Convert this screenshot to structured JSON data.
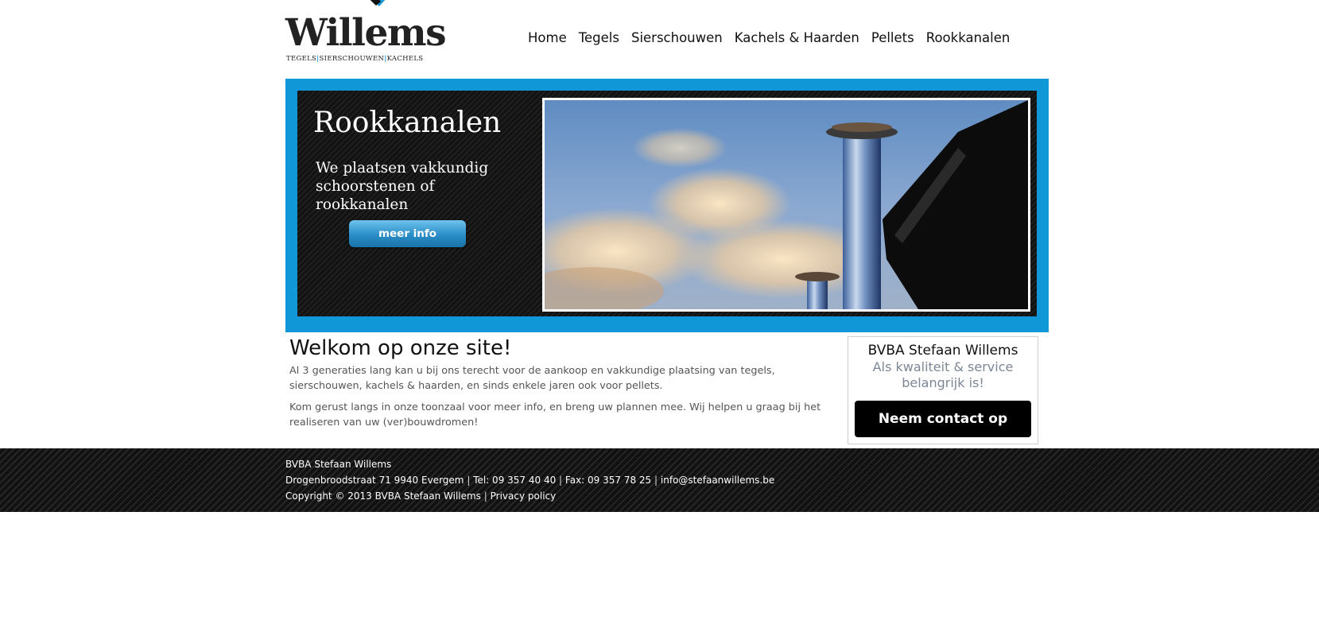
{
  "header": {
    "logo": {
      "word": "Willems",
      "tag_part1": "TEGELS",
      "tag_part2": "SIERSCHOUWEN",
      "tag_part3": "KACHELS",
      "tag_separator": "|",
      "accent_color": "#1b9ad6"
    },
    "nav": [
      {
        "label": "Home"
      },
      {
        "label": "Tegels"
      },
      {
        "label": "Sierschouwen"
      },
      {
        "label": "Kachels & Haarden"
      },
      {
        "label": "Pellets"
      },
      {
        "label": "Rookkanalen"
      }
    ]
  },
  "banner": {
    "title": "Rookkanalen",
    "subtitle": "We plaatsen vakkundig schoorstenen of rookkanalen",
    "button_label": "meer info",
    "frame_color": "#0f97d7"
  },
  "main": {
    "title": "Welkom op onze site!",
    "paragraphs": [
      "Al 3 generaties lang kan u bij ons terecht voor de aankoop en vakkundige plaatsing van tegels, sierschouwen, kachels & haarden, en sinds enkele jaren ook voor pellets.",
      "Kom gerust langs in onze toonzaal voor meer info, en breng uw plannen mee. Wij helpen u graag bij het realiseren van uw (ver)bouwdromen!"
    ]
  },
  "contact_box": {
    "company": "BVBA Stefaan Willems",
    "tagline": "Als kwaliteit & service belangrijk is!",
    "button_label": "Neem contact op"
  },
  "footer": {
    "company": "BVBA Stefaan Willems",
    "address": "Drogenbroodstraat 71 9940 Evergem",
    "tel": "Tel: 09 357 40 40",
    "fax": "Fax: 09 357 78 25",
    "email": "info@stefaanwillems.be",
    "copyright": "Copyright © 2013 BVBA Stefaan Willems",
    "privacy": "Privacy policy",
    "separator": "|"
  }
}
